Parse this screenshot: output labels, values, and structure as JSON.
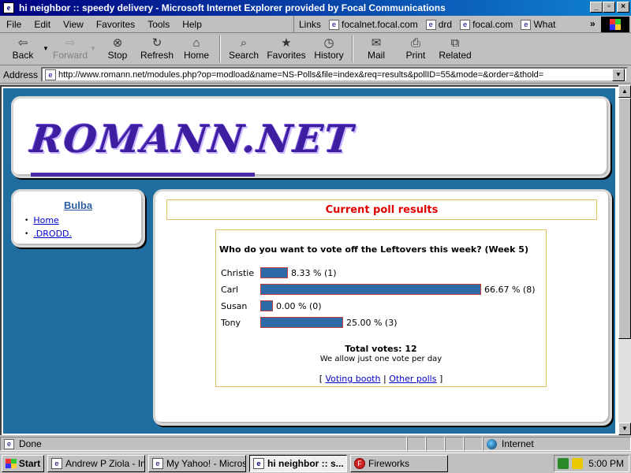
{
  "window": {
    "title": "hi neighbor :: speedy delivery - Microsoft Internet Explorer provided by Focal Communications",
    "minimize": "_",
    "maximize": "▫",
    "close": "×"
  },
  "menu": {
    "items": [
      "File",
      "Edit",
      "View",
      "Favorites",
      "Tools",
      "Help"
    ],
    "links_label": "Links",
    "links": [
      "focalnet.focal.com",
      "drd",
      "focal.com",
      "What"
    ],
    "more": "»"
  },
  "toolbar": {
    "back": "Back",
    "forward": "Forward",
    "stop": "Stop",
    "refresh": "Refresh",
    "home": "Home",
    "search": "Search",
    "favorites": "Favorites",
    "history": "History",
    "mail": "Mail",
    "print": "Print",
    "related": "Related"
  },
  "address": {
    "label": "Address",
    "url": "http://www.romann.net/modules.php?op=modload&name=NS-Polls&file=index&req=results&pollID=55&mode=&order=&thold="
  },
  "site": {
    "logo": "ROMANN.NET",
    "sidebar": {
      "title": "Bulba",
      "items": [
        "Home",
        ".DRODD."
      ]
    },
    "poll": {
      "heading": "Current poll results",
      "question": "Who do you want to vote off the Leftovers this week? (Week 5)",
      "options": [
        {
          "name": "Christie",
          "percent": 8.33,
          "votes": 1,
          "result": "8.33 % (1)"
        },
        {
          "name": "Carl",
          "percent": 66.67,
          "votes": 8,
          "result": "66.67 % (8)"
        },
        {
          "name": "Susan",
          "percent": 0,
          "votes": 0,
          "result": "0.00 % (0)"
        },
        {
          "name": "Tony",
          "percent": 25.0,
          "votes": 3,
          "result": "25.00 % (3)"
        }
      ],
      "total": "Total votes: 12",
      "note": "We allow just one vote per day",
      "link_open": "[",
      "voting_booth": "Voting booth",
      "separator": "|",
      "other_polls": "Other polls",
      "link_close": "]"
    }
  },
  "status": {
    "text": "Done",
    "zone": "Internet"
  },
  "taskbar": {
    "start": "Start",
    "tasks": [
      "Andrew P Ziola - In...",
      "My Yahoo! - Micros...",
      "hi neighbor :: s...",
      "Fireworks"
    ],
    "clock": "5:00 PM"
  },
  "colors": {
    "page_bg": "#1f6e9f",
    "poll_bar": "#2d6aa6",
    "heading_red": "#e00000",
    "link_blue": "#0000cc",
    "logo_purple": "#3d1ea0"
  }
}
